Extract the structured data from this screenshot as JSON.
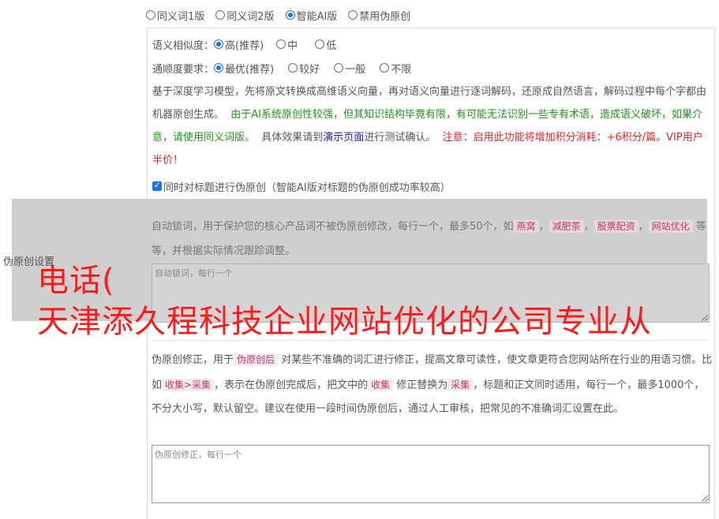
{
  "version_options": [
    {
      "label": "同义词1版",
      "selected": false
    },
    {
      "label": "同义词2版",
      "selected": false
    },
    {
      "label": "智能AI版",
      "selected": true
    },
    {
      "label": "禁用伪原创",
      "selected": false
    }
  ],
  "similarity": {
    "label": "语义相似度：",
    "options": [
      {
        "label": "高(推荐)",
        "selected": true
      },
      {
        "label": "中",
        "selected": false
      },
      {
        "label": "低",
        "selected": false
      }
    ]
  },
  "fluency": {
    "label": "通顺度要求：",
    "options": [
      {
        "label": "最优(推荐)",
        "selected": true
      },
      {
        "label": "较好",
        "selected": false
      },
      {
        "label": "一般",
        "selected": false
      },
      {
        "label": "不限",
        "selected": false
      }
    ]
  },
  "description": {
    "part1": "基于深度学习模型，先将原文转换成高维语义向量，再对语义向量进行逐词解码，还原成自然语言，解码过程中每个字都由机器原创生成。",
    "part2_green": "由于AI系统原创性较强，但其知识结构毕竟有限，有可能无法识别一些专有术语，造成语义破坏，如果介意，请使用同义词版。",
    "part3": "具体效果请到",
    "demo_link": "演示页面",
    "part4": "进行测试确认。",
    "part5_red": "注意：启用此功能将增加积分消耗：+6积分/篇。VIP用户半价！"
  },
  "title_checkbox": {
    "label": "同时对标题进行伪原创（智能AI版对标题的伪原创成功率较高）",
    "checked": true
  },
  "settings_label": "伪原创设置",
  "lock": {
    "text1": "自动锁词，用于保护您的核心产品词不被伪原创修改，每行一个，最多50个，如",
    "tags": [
      "燕窝",
      "减肥茶",
      "股票配资",
      "网站优化"
    ],
    "sep": "，",
    "text2": "等等，并根据实际情况跟踪调整。",
    "placeholder": "自动锁词，每行一个"
  },
  "fix": {
    "t1": "伪原创修正，用于",
    "tag1": "伪原创后",
    "t2": "对某些不准确的词汇进行修正，提高文章可读性，使文章更符合您网站所在行业的用语习惯。比如",
    "tag2": "收集>采集",
    "t3": "，表示在伪原创完成后，把文中的",
    "tag3": "收集",
    "t4": "修正替换为",
    "tag4": "采集",
    "t5": "，标题和正文同时适用，每行一个，最多1000个，不分大小写，默认留空。建议在使用一段时间伪原创后，通过人工审核，把常见的不准确词汇设置在此。",
    "placeholder": "伪原创修正，每行一个"
  },
  "overlay": {
    "line1": "电话(",
    "line2": "天津添久程科技企业网站优化的公司专业从"
  }
}
